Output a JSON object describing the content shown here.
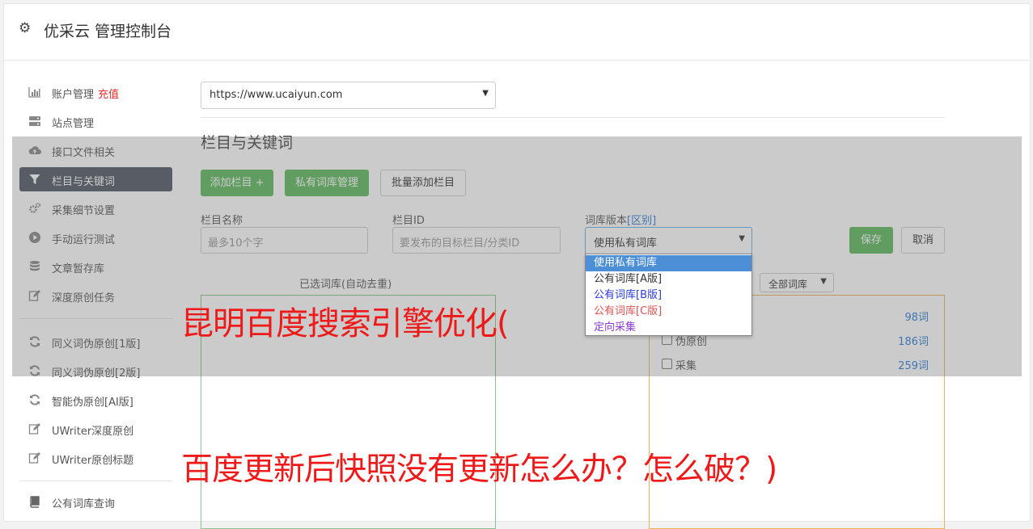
{
  "header": {
    "title": "优采云 管理控制台"
  },
  "sidebar": {
    "items": [
      {
        "label": "账户管理",
        "extra": "充值",
        "icon": "bar-chart-icon"
      },
      {
        "label": "站点管理",
        "icon": "server-icon"
      },
      {
        "label": "接口文件相关",
        "icon": "cloud-upload-icon"
      },
      {
        "label": "栏目与关键词",
        "icon": "filter-icon",
        "active": true
      },
      {
        "label": "采集细节设置",
        "icon": "gears-icon"
      },
      {
        "label": "手动运行测试",
        "icon": "play-circle-icon"
      },
      {
        "label": "文章暂存库",
        "icon": "database-icon"
      },
      {
        "label": "深度原创任务",
        "icon": "edit-icon"
      },
      {
        "label": "同义词伪原创[1版]",
        "icon": "refresh-icon"
      },
      {
        "label": "同义词伪原创[2版]",
        "icon": "refresh-icon"
      },
      {
        "label": "智能伪原创[AI版]",
        "icon": "refresh-icon"
      },
      {
        "label": "UWriter深度原创",
        "icon": "edit-icon"
      },
      {
        "label": "UWriter原创标题",
        "icon": "edit-icon"
      },
      {
        "label": "公有词库查询",
        "icon": "book-icon"
      }
    ]
  },
  "main": {
    "site_select": "https://www.ucaiyun.com",
    "section_title": "栏目与关键词",
    "buttons": {
      "add_column": "添加栏目 +",
      "private_lib": "私有词库管理",
      "batch_add": "批量添加栏目"
    },
    "form": {
      "name_label": "栏目名称",
      "name_placeholder": "最多10个字",
      "id_label": "栏目ID",
      "id_placeholder": "要发布的目标栏目/分类ID",
      "version_label": "词库版本",
      "version_link": "[区别]",
      "version_value": "使用私有词库",
      "save": "保存",
      "cancel": "取消"
    },
    "dropdown_options": [
      {
        "label": "使用私有词库",
        "color": "#ffffff",
        "selected": true
      },
      {
        "label": "公有词库[A版]",
        "color": "#333333"
      },
      {
        "label": "公有词库[B版]",
        "color": "#2b3bd6"
      },
      {
        "label": "公有词库[C版]",
        "color": "#d9534f"
      },
      {
        "label": "定向采集",
        "color": "#8a3bd6"
      }
    ],
    "selected_lib_label": "已选词库(自动去重)",
    "all_lib_select": "全部词库",
    "lib_options": [
      {
        "name": "",
        "count": "98词"
      },
      {
        "name": "伪原创",
        "count": "186词"
      },
      {
        "name": "采集",
        "count": "259词"
      }
    ]
  },
  "watermark": {
    "line1": "昆明百度搜索引擎优化(",
    "line2": "百度更新后快照没有更新怎么办？怎么破？)"
  }
}
